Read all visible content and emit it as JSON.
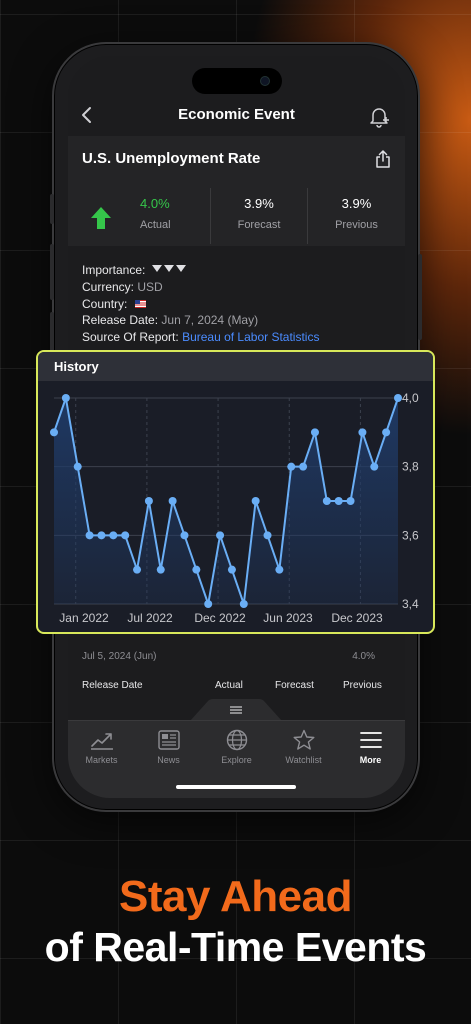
{
  "app": {
    "nav_title": "Economic Event",
    "event_title": "U.S. Unemployment Rate"
  },
  "stats": {
    "actual_value": "4.0%",
    "actual_label": "Actual",
    "forecast_value": "3.9%",
    "forecast_label": "Forecast",
    "previous_value": "3.9%",
    "previous_label": "Previous",
    "actual_color": "#35c64a"
  },
  "details": {
    "importance_label": "Importance:",
    "currency_label": "Currency:",
    "currency_value": "USD",
    "country_label": "Country:",
    "country_flag": "us-flag-icon",
    "release_date_label": "Release Date:",
    "release_date_value": "Jun 7, 2024 (May)",
    "source_label": "Source Of Report:",
    "source_value": "Bureau of Labor Statistics"
  },
  "history_table": {
    "first_row_date": "Jul 5, 2024 (Jun)",
    "first_row_value": "4.0%",
    "col_release_date": "Release Date",
    "col_actual": "Actual",
    "col_forecast": "Forecast",
    "col_previous": "Previous"
  },
  "tabs": [
    {
      "label": "Markets",
      "icon": "chart-trend-icon"
    },
    {
      "label": "News",
      "icon": "newspaper-icon"
    },
    {
      "label": "Explore",
      "icon": "globe-icon"
    },
    {
      "label": "Watchlist",
      "icon": "star-icon"
    },
    {
      "label": "More",
      "icon": "menu-icon",
      "active": true
    }
  ],
  "history_card": {
    "title": "History"
  },
  "chart_data": {
    "type": "line",
    "title": "History",
    "x_tick_labels": [
      "Jan 2022",
      "Jul 2022",
      "Dec 2022",
      "Jun 2023",
      "Dec 2023"
    ],
    "y_tick_labels": [
      "4,0",
      "3,8",
      "3,6",
      "3,4"
    ],
    "ylim": [
      3.4,
      4.0
    ],
    "grid": true,
    "series": [
      {
        "values": [
          3.9,
          4.0,
          3.8,
          3.6,
          3.6,
          3.6,
          3.6,
          3.5,
          3.7,
          3.5,
          3.7,
          3.6,
          3.5,
          3.4,
          3.6,
          3.5,
          3.4,
          3.7,
          3.6,
          3.5,
          3.8,
          3.8,
          3.9,
          3.7,
          3.7,
          3.7,
          3.9,
          3.8,
          3.9,
          4.0
        ]
      }
    ],
    "colors": {
      "line": "#6aaef5",
      "fill": "#1f3a66",
      "accent": "#d8e85a"
    }
  },
  "marketing": {
    "headline_line1": "Stay Ahead",
    "headline_line2": "of Real-Time Events",
    "headline_color": "#f26a1b"
  }
}
